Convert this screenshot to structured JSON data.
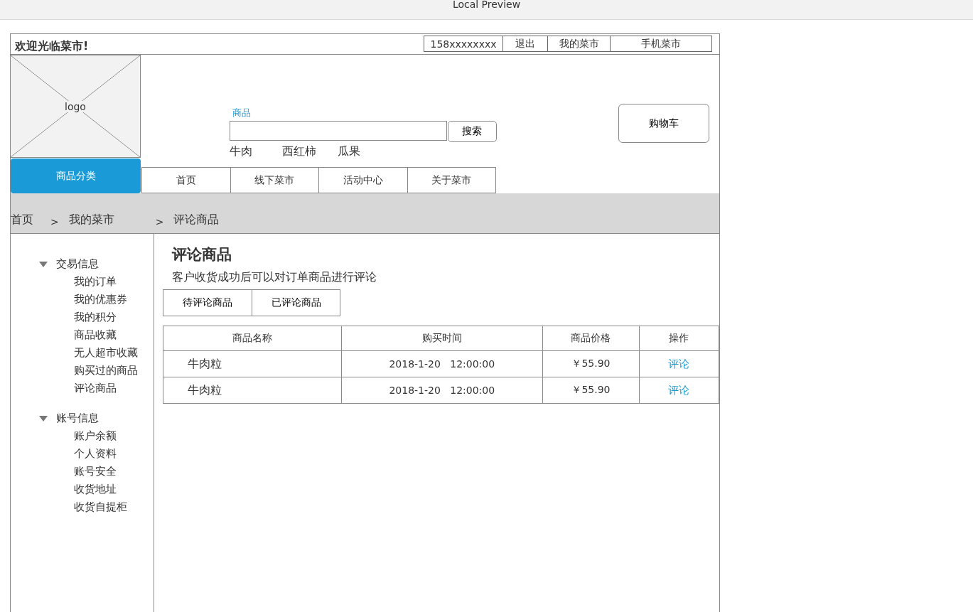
{
  "window": {
    "title": "Local Preview"
  },
  "top_bar": {
    "welcome": "欢迎光临菜市!",
    "links": [
      "158xxxxxxxx",
      "退出",
      "我的菜市",
      "手机菜市"
    ]
  },
  "header": {
    "logo": "logo",
    "category_button": "商品分类",
    "search": {
      "label": "商品",
      "button": "搜索",
      "hot_words": [
        "牛肉",
        "西红柿",
        "瓜果"
      ]
    },
    "cart_button": "购物车"
  },
  "nav": [
    "首页",
    "线下菜市",
    "活动中心",
    "关于菜市"
  ],
  "breadcrumb": [
    {
      "label": "首页"
    },
    {
      "label": "我的菜市",
      "separator": ">"
    },
    {
      "label": "评论商品",
      "separator": ">"
    }
  ],
  "sidebar": {
    "groups": [
      {
        "title": "交易信息",
        "expanded": true,
        "items": [
          "我的订单",
          "我的优惠券",
          "我的积分",
          "商品收藏",
          "无人超市收藏",
          "购买过的商品",
          "评论商品"
        ]
      },
      {
        "title": "账号信息",
        "expanded": true,
        "items": [
          "账户余额",
          "个人资料",
          "账号安全",
          "收货地址",
          "收货自提柜"
        ]
      }
    ]
  },
  "content": {
    "title": "评论商品",
    "description": "客户收货成功后可以对订单商品进行评论",
    "tabs": [
      "待评论商品",
      "已评论商品"
    ],
    "table": {
      "columns": [
        "商品名称",
        "购买时间",
        "商品价格",
        "操作"
      ],
      "rows": [
        {
          "name": "牛肉粒",
          "time": "2018-1-20   12:00:00",
          "price": "￥55.90",
          "action": "评论"
        },
        {
          "name": "牛肉粒",
          "time": "2018-1-20   12:00:00",
          "price": "￥55.90",
          "action": "评论"
        }
      ]
    }
  }
}
